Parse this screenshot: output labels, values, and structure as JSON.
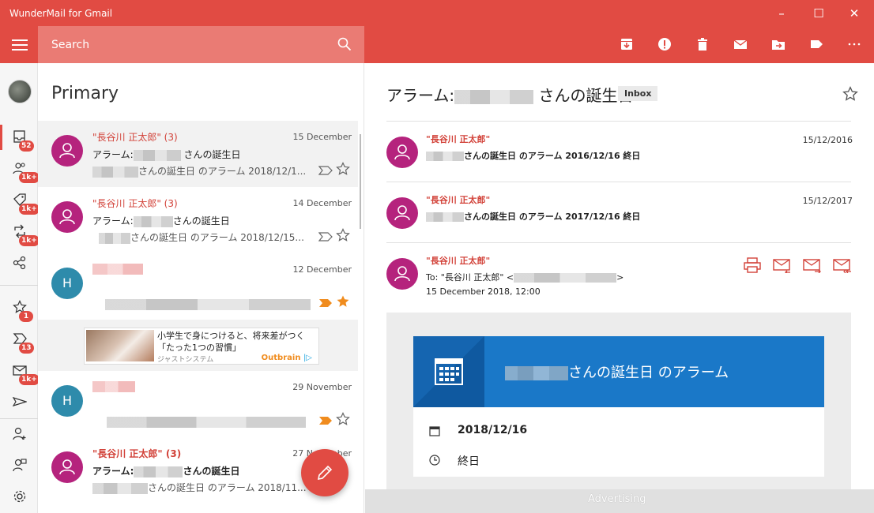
{
  "window": {
    "title": "WunderMail for Gmail",
    "controls": [
      "minimize",
      "maximize",
      "close"
    ]
  },
  "search": {
    "placeholder": "Search"
  },
  "toolbar": {
    "icons": [
      "archive-icon",
      "report-spam-icon",
      "delete-icon",
      "mark-unread-icon",
      "move-to-icon",
      "label-icon",
      "more-icon"
    ]
  },
  "nav": {
    "items": [
      {
        "name": "inbox",
        "badge": "52"
      },
      {
        "name": "social",
        "badge": "1k+"
      },
      {
        "name": "promotions",
        "badge": "1k+"
      },
      {
        "name": "updates",
        "badge": "1k+"
      },
      {
        "name": "forums",
        "badge": ""
      },
      {
        "name": "starred",
        "badge": "1"
      },
      {
        "name": "important",
        "badge": "13"
      },
      {
        "name": "all-mail",
        "badge": "1k+"
      },
      {
        "name": "sent",
        "badge": ""
      },
      {
        "name": "add-account",
        "badge": ""
      },
      {
        "name": "feedback",
        "badge": ""
      },
      {
        "name": "settings",
        "badge": ""
      }
    ]
  },
  "list": {
    "title": "Primary",
    "items": [
      {
        "from": "\"長谷川 正太郎\" (3)",
        "date": "15 December",
        "subject_prefix": "アラーム:",
        "subject_suffix": "さんの誕生日",
        "preview_suffix": "さんの誕生日 のアラーム 2018/12/1...",
        "avatar": "person",
        "avatar_color": "#b5237d",
        "bold": false
      },
      {
        "from": "\"長谷川 正太郎\" (3)",
        "date": "14 December",
        "subject_prefix": "アラーム:",
        "subject_suffix": "さんの誕生日",
        "preview_suffix": "さんの誕生日 のアラーム 2018/12/15...",
        "avatar": "person",
        "avatar_color": "#b5237d",
        "bold": false
      },
      {
        "from": "",
        "date": "12 December",
        "subject_prefix": "",
        "subject_suffix": "",
        "preview_suffix": "",
        "avatar": "H",
        "avatar_color": "#2e8bab",
        "bold": false
      },
      {
        "from": "",
        "date": "29 November",
        "subject_prefix": "",
        "subject_suffix": "",
        "preview_suffix": "",
        "avatar": "H",
        "avatar_color": "#2e8bab",
        "bold": false
      },
      {
        "from": "\"長谷川 正太郎\" (3)",
        "date": "27 November",
        "subject_prefix": "アラーム:",
        "subject_suffix": "さんの誕生日",
        "preview_suffix": "さんの誕生日 のアラーム 2018/11...",
        "avatar": "person",
        "avatar_color": "#b5237d",
        "bold": true
      }
    ],
    "ad": {
      "text": "小学生で身につけると、将来差がつく「たった1つの習慣」",
      "source": "ジャストシステム",
      "brand": "Outbrain",
      "brand_mark": "|▷"
    }
  },
  "message": {
    "subject_prefix": "アラーム:",
    "subject_suffix": "さんの誕生日",
    "label": "Inbox",
    "thread": [
      {
        "from": "\"長谷川 正太郎\"",
        "snippet": "さんの誕生日 のアラーム 2016/12/16 終日",
        "date": "15/12/2016"
      },
      {
        "from": "\"長谷川 正太郎\"",
        "snippet": "さんの誕生日 のアラーム 2017/12/16 終日",
        "date": "15/12/2017"
      }
    ],
    "open": {
      "from": "\"長谷川 正太郎\"",
      "to_prefix": "To: \"長谷川 正太郎\" <",
      "to_suffix": ">",
      "datetime": "15 December 2018, 12:00",
      "actions": [
        "print-icon",
        "reply-icon",
        "forward-icon",
        "reply-all-icon"
      ]
    },
    "card": {
      "title_suffix": "さんの誕生日 のアラーム",
      "date": "2018/12/16",
      "time": "終日"
    },
    "advertising": "Advertising"
  },
  "colors": {
    "accent": "#e14b43",
    "search_bg": "#ea7b74",
    "avatar_magenta": "#b5237d",
    "avatar_teal": "#2e8bab",
    "card_blue": "#1a78c8",
    "important_orange": "#f08c1e"
  }
}
